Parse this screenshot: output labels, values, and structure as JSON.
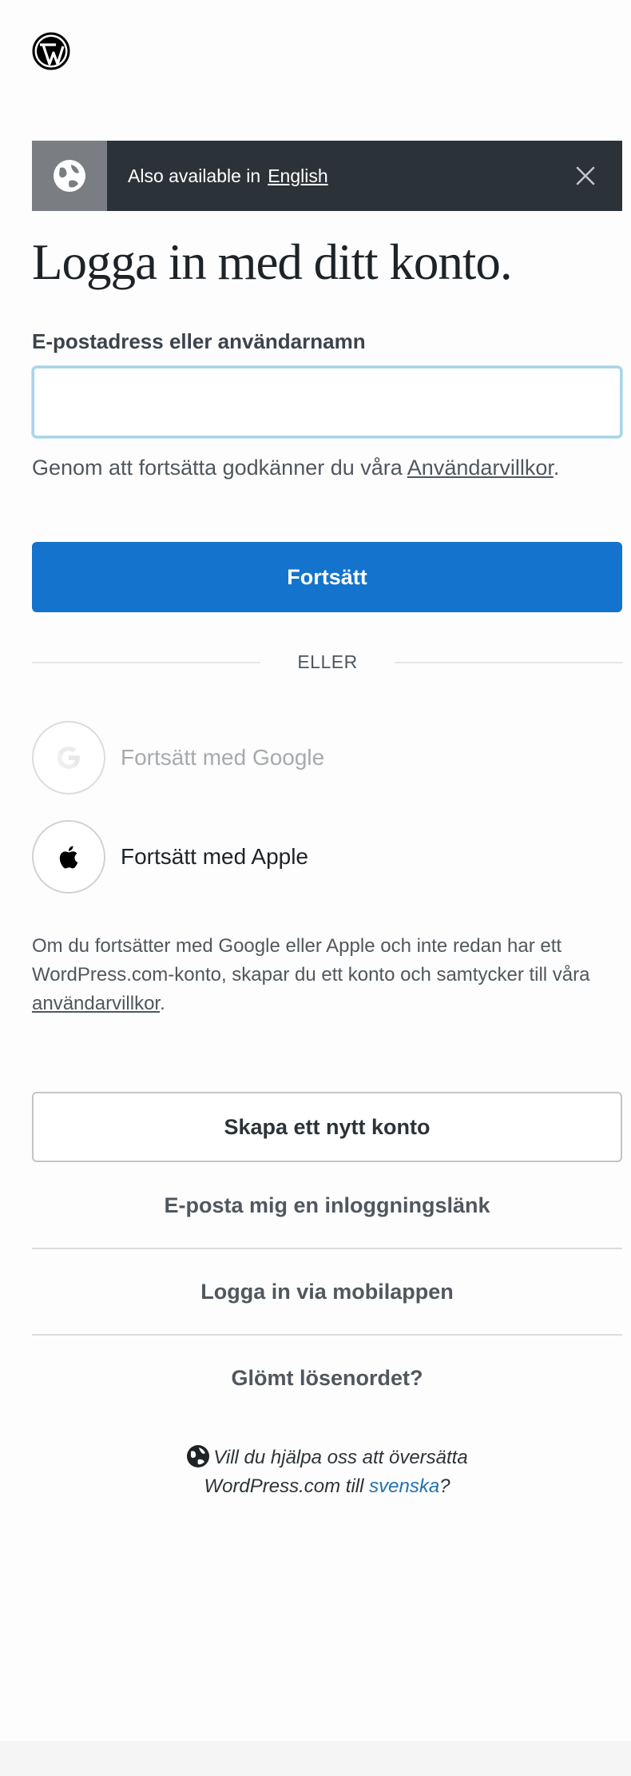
{
  "banner": {
    "text": "Also available in",
    "link": "English"
  },
  "heading": "Logga in med ditt konto.",
  "login_field": {
    "label": "E-postadress eller användarnamn",
    "value": "",
    "placeholder": ""
  },
  "terms": {
    "text": "Genom att fortsätta godkänner du våra",
    "link": "Användarvillkor",
    "suffix": "."
  },
  "continue_label": "Fortsätt",
  "divider_text": "ELLER",
  "social": {
    "google_label": "Fortsätt med Google",
    "apple_label": "Fortsätt med Apple"
  },
  "disclaimer": {
    "text": "Om du fortsätter med Google eller Apple och inte redan har ett WordPress.com-konto, skapar du ett konto och samtycker till våra",
    "link": "användarvillkor",
    "suffix": "."
  },
  "actions": {
    "create_account": "Skapa ett nytt konto",
    "email_link": "E-posta mig en inloggningslänk",
    "mobile_app": "Logga in via mobilappen",
    "lost_password": "Glömt lösenordet?"
  },
  "translate": {
    "line1": "Vill du hjälpa oss att översätta",
    "line2": "WordPress.com till",
    "link": "svenska",
    "suffix": "?"
  },
  "colors": {
    "primary": "#1473cc",
    "banner_bg": "#2c3338",
    "link": "#2271b1"
  }
}
